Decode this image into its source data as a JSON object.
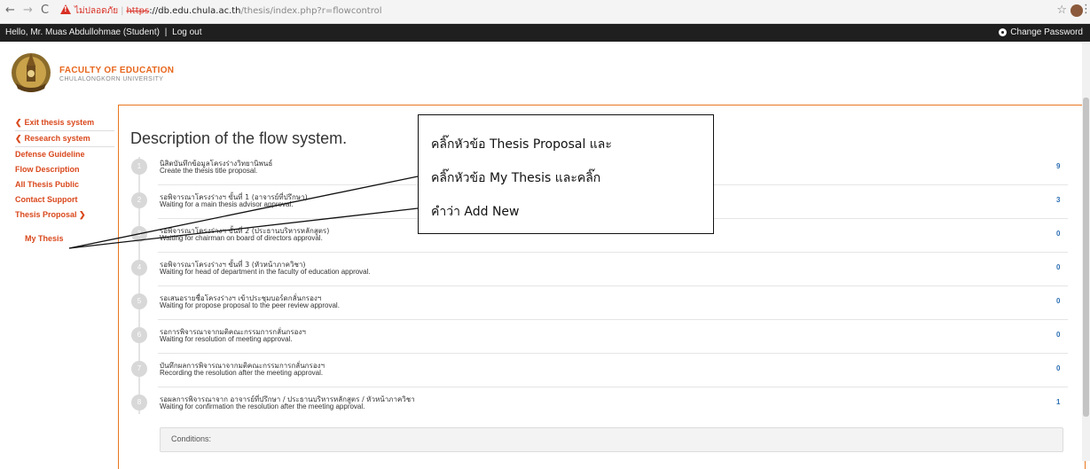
{
  "browser": {
    "insecure_label": "ไม่ปลอดภัย",
    "url_scheme": "https",
    "url_host": "db.edu.chula.ac.th",
    "url_path": "/thesis/index.php?r=flowcontrol"
  },
  "topbar": {
    "greeting": "Hello, Mr. Muas Abdullohmae (Student)",
    "separator": "|",
    "logout": "Log out",
    "change_password": "Change Password"
  },
  "header": {
    "faculty": "FACULTY OF EDUCATION",
    "university": "CHULALONGKORN UNIVERSITY"
  },
  "sidebar": {
    "items": [
      {
        "label": "Exit thesis system",
        "icon": "chevron-left-icon"
      },
      {
        "label": "Research system",
        "icon": "chevron-left-icon"
      },
      {
        "label": "Defense Guideline"
      },
      {
        "label": "Flow Description"
      },
      {
        "label": "All Thesis Public"
      },
      {
        "label": "Contact Support"
      },
      {
        "label": "Thesis Proposal",
        "icon": "chevron-down-icon"
      }
    ],
    "sub_item": "My Thesis"
  },
  "main": {
    "title": "Description of the flow system.",
    "steps": [
      {
        "num": "1",
        "th": "นิสิตบันทึกข้อมูลโครงร่างวิทยานิพนธ์",
        "en": "Create the thesis title proposal.",
        "count": "9"
      },
      {
        "num": "2",
        "th": "รอพิจารณาโครงร่างฯ ขั้นที่ 1 (อาจารย์ที่ปรึกษา)",
        "en": "Waiting for a main thesis advisor approval.",
        "count": "3"
      },
      {
        "num": "3",
        "th": "รอพิจารณาโครงร่างฯ ขั้นที่ 2 (ประธานบริหารหลักสูตร)",
        "en": "Waiting for chairman on board of directors approval.",
        "count": "0"
      },
      {
        "num": "4",
        "th": "รอพิจารณาโครงร่างฯ ขั้นที่ 3 (หัวหน้าภาควิชา)",
        "en": "Waiting for head of department in the faculty of education approval.",
        "count": "0"
      },
      {
        "num": "5",
        "th": "รอเสนอรายชื่อโครงร่างฯ เข้าประชุมบอร์ดกลั่นกรองฯ",
        "en": "Waiting for propose proposal to the peer review approval.",
        "count": "0"
      },
      {
        "num": "6",
        "th": "รอการพิจารณาจากมติคณะกรรมการกลั่นกรองฯ",
        "en": "Waiting for resolution of meeting approval.",
        "count": "0"
      },
      {
        "num": "7",
        "th": "บันทึกผลการพิจารณาจากมติคณะกรรมการกลั่นกรองฯ",
        "en": "Recording the resolution after the meeting approval.",
        "count": "0"
      },
      {
        "num": "8",
        "th": "รอผลการพิจารณาจาก อาจารย์ที่ปรึกษา / ประธานบริหารหลักสูตร / หัวหน้าภาควิชา",
        "en": "Waiting for confirmation the resolution after the meeting approval.",
        "count": "1"
      }
    ],
    "conditions_label": "Conditions:"
  },
  "callout": {
    "line1": "คลิ๊กหัวข้อ Thesis Proposal และ",
    "line2": "คลิ๊กหัวข้อ My Thesis และคลิ๊ก",
    "line3": "คำว่า Add New"
  },
  "colors": {
    "accent": "#e8761f",
    "link": "#d9481c",
    "count": "#2d6fb3"
  }
}
